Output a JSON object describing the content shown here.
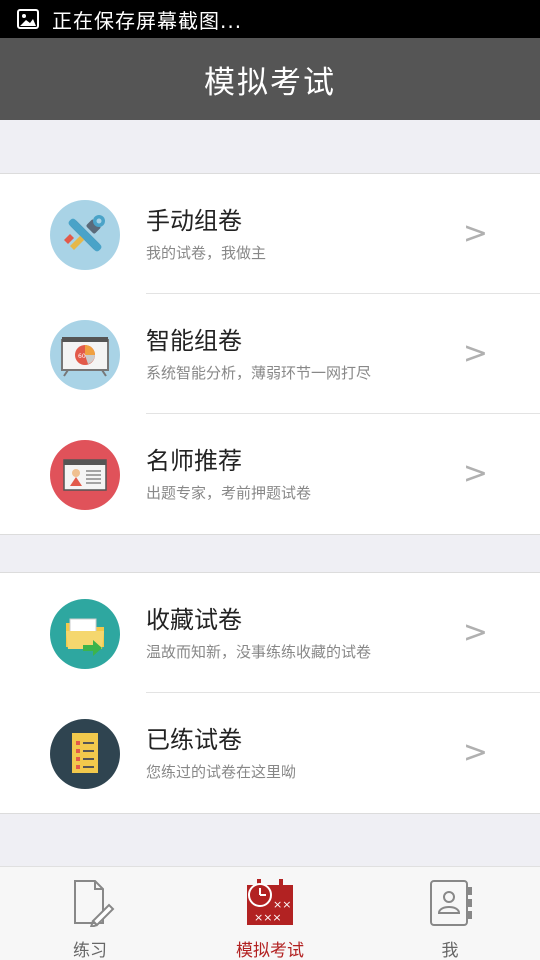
{
  "status_bar": {
    "text": "正在保存屏幕截图..."
  },
  "header": {
    "title": "模拟考试"
  },
  "groups": [
    {
      "items": [
        {
          "title": "手动组卷",
          "subtitle": "我的试卷，我做主",
          "icon": "tools-icon",
          "arrow": ">"
        },
        {
          "title": "智能组卷",
          "subtitle": "系统智能分析，薄弱环节一网打尽",
          "icon": "chart-board-icon",
          "arrow": ">"
        },
        {
          "title": "名师推荐",
          "subtitle": "出题专家，考前押题试卷",
          "icon": "teacher-board-icon",
          "arrow": ">"
        }
      ]
    },
    {
      "items": [
        {
          "title": "收藏试卷",
          "subtitle": "温故而知新，没事练练收藏的试卷",
          "icon": "folder-star-icon",
          "arrow": ">"
        },
        {
          "title": "已练试卷",
          "subtitle": "您练过的试卷在这里呦",
          "icon": "document-list-icon",
          "arrow": ">"
        }
      ]
    }
  ],
  "tab_bar": {
    "tabs": [
      {
        "label": "练习",
        "icon": "pencil-document-icon",
        "active": false
      },
      {
        "label": "模拟考试",
        "icon": "clock-calendar-icon",
        "active": true
      },
      {
        "label": "我",
        "icon": "contact-book-icon",
        "active": false
      }
    ]
  },
  "colors": {
    "header_bg": "#555555",
    "active_tab": "#b22222",
    "background": "#efeff4"
  }
}
